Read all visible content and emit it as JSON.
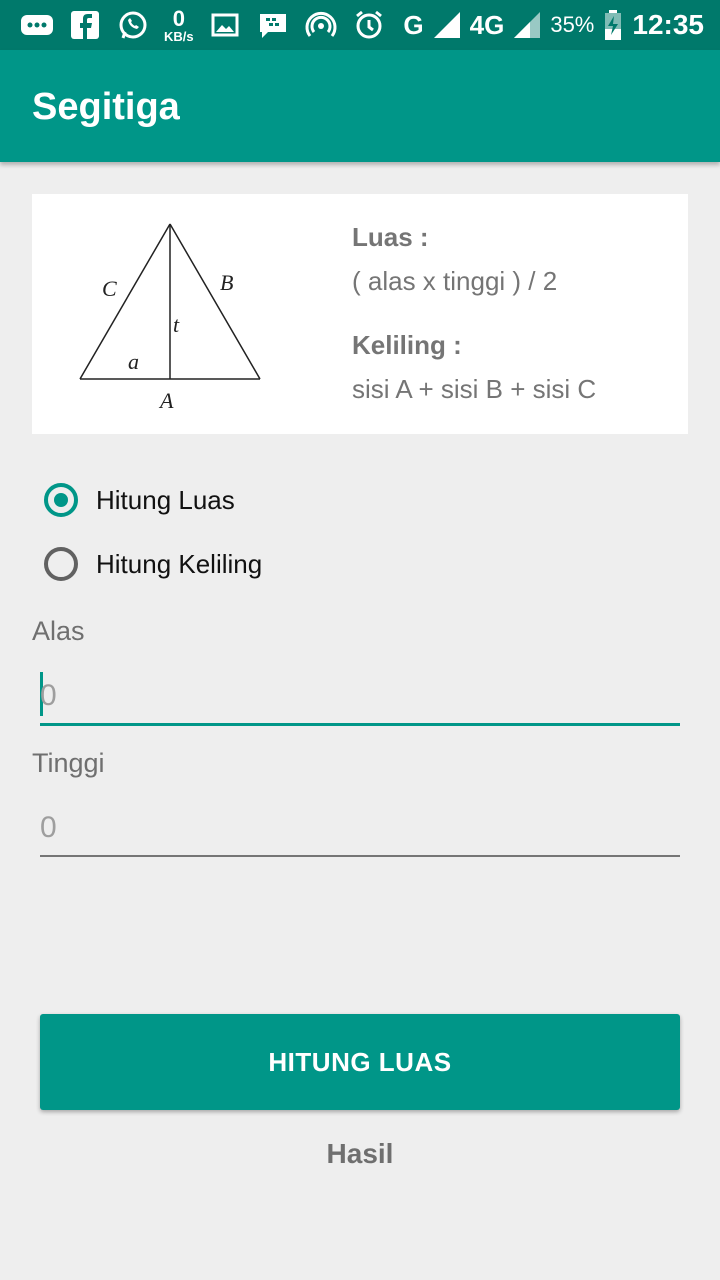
{
  "status_bar": {
    "kbs_value": "0",
    "kbs_unit": "KB/s",
    "network_g": "G",
    "network_4g": "4G",
    "battery": "35%",
    "time": "12:35"
  },
  "app_bar": {
    "title": "Segitiga"
  },
  "formula_card": {
    "diagram_labels": {
      "C": "C",
      "B": "B",
      "t": "t",
      "a": "a",
      "A": "A"
    },
    "luas_label": "Luas :",
    "luas_formula": "( alas x tinggi ) / 2",
    "keliling_label": "Keliling :",
    "keliling_formula": "sisi A + sisi B + sisi C"
  },
  "options": [
    {
      "label": "Hitung Luas",
      "selected": true
    },
    {
      "label": "Hitung Keliling",
      "selected": false
    }
  ],
  "alas": {
    "label": "Alas",
    "placeholder": "0"
  },
  "tinggi": {
    "label": "Tinggi",
    "placeholder": "0"
  },
  "button": {
    "label": "HITUNG LUAS"
  },
  "result": {
    "label": "Hasil"
  },
  "colors": {
    "primary": "#009688",
    "primary_dark": "#00796b"
  }
}
